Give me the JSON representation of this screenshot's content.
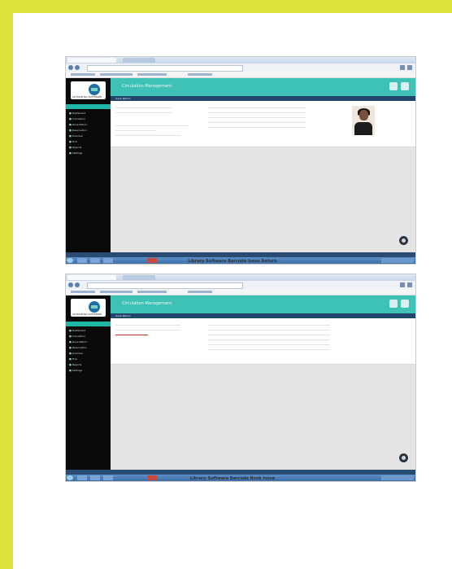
{
  "screenshots": [
    {
      "app": {
        "title": "Circulation Management",
        "logo_text": "AUTOLIB NG SOFTWARE",
        "panel_header": "Issue Return",
        "menu": [
          "Dashboard",
          "Circulation",
          "Issue Return",
          "Reservation",
          "Overdue",
          "Fine",
          "Reports",
          "Settings"
        ]
      },
      "caption": "Library Software Barcode Issue Return"
    },
    {
      "app": {
        "title": "Circulation Management",
        "logo_text": "AUTOLIB NG SOFTWARE",
        "panel_header": "Issue Return",
        "menu": [
          "Dashboard",
          "Circulation",
          "Issue Return",
          "Reservation",
          "Overdue",
          "Fine",
          "Reports",
          "Settings"
        ]
      },
      "caption": "Library Software Barcode Book Issue"
    }
  ],
  "colors": {
    "background": "#dde33a",
    "topbar": "#3ec2b6",
    "sidebar": "#0a0a0a",
    "error": "#c62828"
  },
  "icons": [
    "user-icon",
    "bell-icon",
    "help-fab-icon"
  ]
}
